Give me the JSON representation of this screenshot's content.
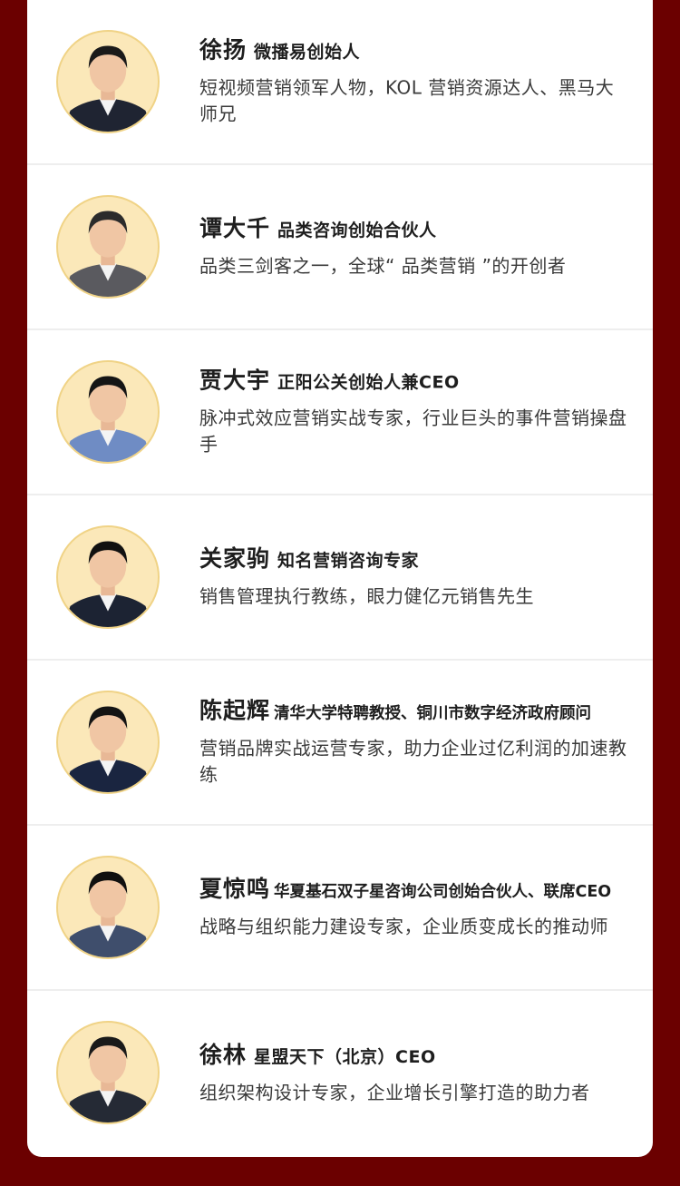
{
  "speakers": [
    {
      "name": "徐扬",
      "title": "微播易创始人",
      "desc": "短视频营销领军人物，KOL 营销资源达人、黑马大师兄",
      "shirt_color": "#1f2432",
      "hair_color": "#1a1a1a"
    },
    {
      "name": "谭大千",
      "title": "品类咨询创始合伙人",
      "desc": "品类三剑客之一，全球“ 品类营销 ”的开创者",
      "shirt_color": "#5a5a5f",
      "hair_color": "#2b2b2b"
    },
    {
      "name": "贾大宇",
      "title": "正阳公关创始人兼CEO",
      "desc": "脉冲式效应营销实战专家，行业巨头的事件营销操盘手",
      "shirt_color": "#6f8cc4",
      "hair_color": "#151515"
    },
    {
      "name": "关家驹",
      "title": "知名营销咨询专家",
      "desc": "销售管理执行教练，眼力健亿元销售先生",
      "shirt_color": "#1c2333",
      "hair_color": "#111111"
    },
    {
      "name": "陈起辉",
      "title": "清华大学特聘教授、铜川市数字经济政府顾问",
      "desc": "营销品牌实战运营专家，助力企业过亿利润的加速教练",
      "shirt_color": "#1a2540",
      "hair_color": "#141414"
    },
    {
      "name": "夏惊鸣",
      "title": "华夏基石双子星咨询公司创始合伙人、联席CEO",
      "desc": "战略与组织能力建设专家，企业质变成长的推动师",
      "shirt_color": "#3f4e6c",
      "hair_color": "#101010"
    },
    {
      "name": "徐林",
      "title": "星盟天下（北京）CEO",
      "desc": "组织架构设计专家，企业增长引擎打造的助力者",
      "shirt_color": "#252a35",
      "hair_color": "#1a1a1a"
    }
  ]
}
